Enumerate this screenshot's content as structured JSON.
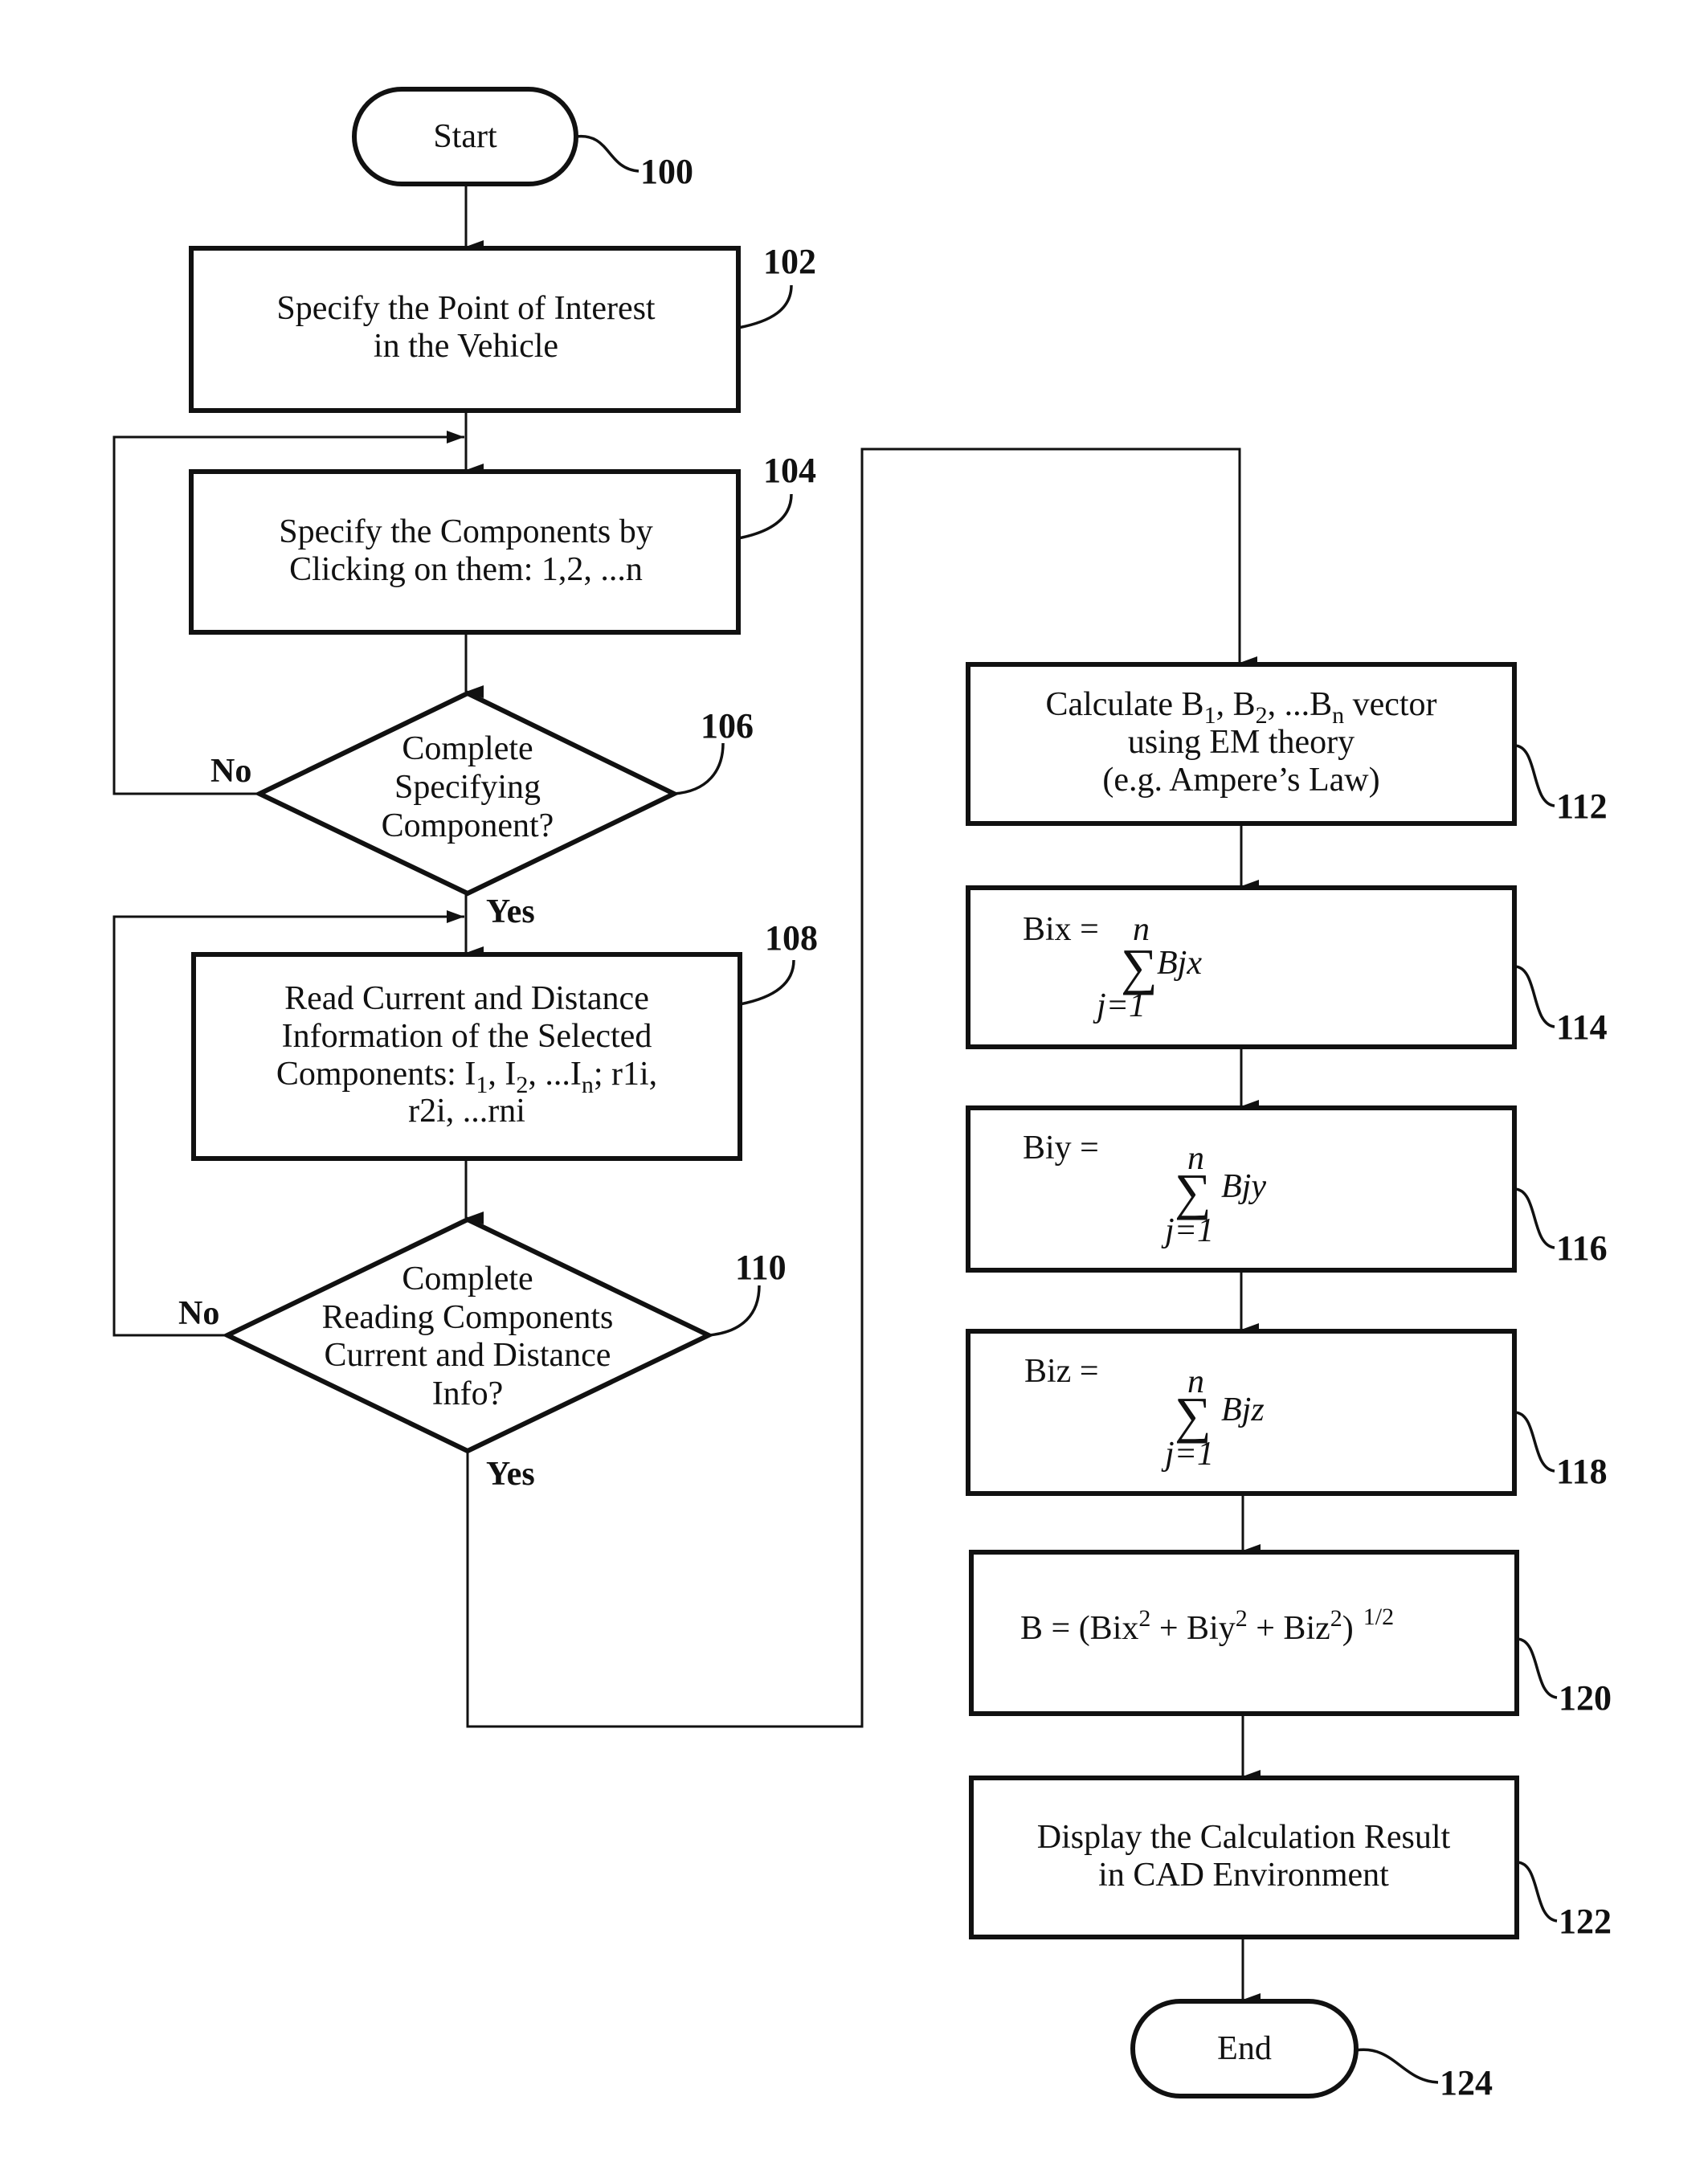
{
  "diagram": {
    "type": "flowchart",
    "nodes": {
      "start": {
        "ref": "100",
        "label": "Start"
      },
      "n102": {
        "ref": "102",
        "lines": [
          "Specify the Point of Interest",
          "in the Vehicle"
        ]
      },
      "n104": {
        "ref": "104",
        "lines": [
          "Specify the Components by",
          "Clicking on them: 1,2, ...n"
        ]
      },
      "n106": {
        "ref": "106",
        "lines": [
          "Complete",
          "Specifying",
          "Component?"
        ],
        "no": "No",
        "yes": "Yes"
      },
      "n108": {
        "ref": "108",
        "line1": "Read Current and Distance",
        "line2": "Information of the Selected",
        "line3_a": "Components: I",
        "line3_s1": "1",
        "line3_b": ", I",
        "line3_s2": "2",
        "line3_c": ", ...I",
        "line3_s3": "n",
        "line3_d": "; r1i,",
        "line4": "r2i, ...rni"
      },
      "n110": {
        "ref": "110",
        "lines": [
          "Complete",
          "Reading Components",
          "Current and Distance",
          "Info?"
        ],
        "no": "No",
        "yes": "Yes"
      },
      "n112": {
        "ref": "112",
        "line1_a": "Calculate B",
        "line1_s1": "1",
        "line1_b": ", B",
        "line1_s2": "2",
        "line1_c": ", ...B",
        "line1_s3": "n",
        "line1_d": " vector",
        "line2": "using EM theory",
        "line3": "(e.g. Ampere’s Law)"
      },
      "n114": {
        "ref": "114",
        "lhs": "Bix =",
        "upper": "n",
        "sigma": "∑",
        "term": "Bjx",
        "lower": "j=1"
      },
      "n116": {
        "ref": "116",
        "lhs": "Biy =",
        "upper": "n",
        "sigma": "∑",
        "term": "Bjy",
        "lower": "j=1"
      },
      "n118": {
        "ref": "118",
        "lhs": "Biz =",
        "upper": "n",
        "sigma": "∑",
        "term": "Bjz",
        "lower": "j=1"
      },
      "n120": {
        "ref": "120",
        "a": "B = (Bix",
        "sq": "2",
        "b": " + Biy",
        "c": " + Biz",
        "d": ")",
        "exp": "1/2"
      },
      "n122": {
        "ref": "122",
        "lines": [
          "Display the Calculation Result",
          "in CAD Environment"
        ]
      },
      "end": {
        "ref": "124",
        "label": "End"
      }
    }
  }
}
